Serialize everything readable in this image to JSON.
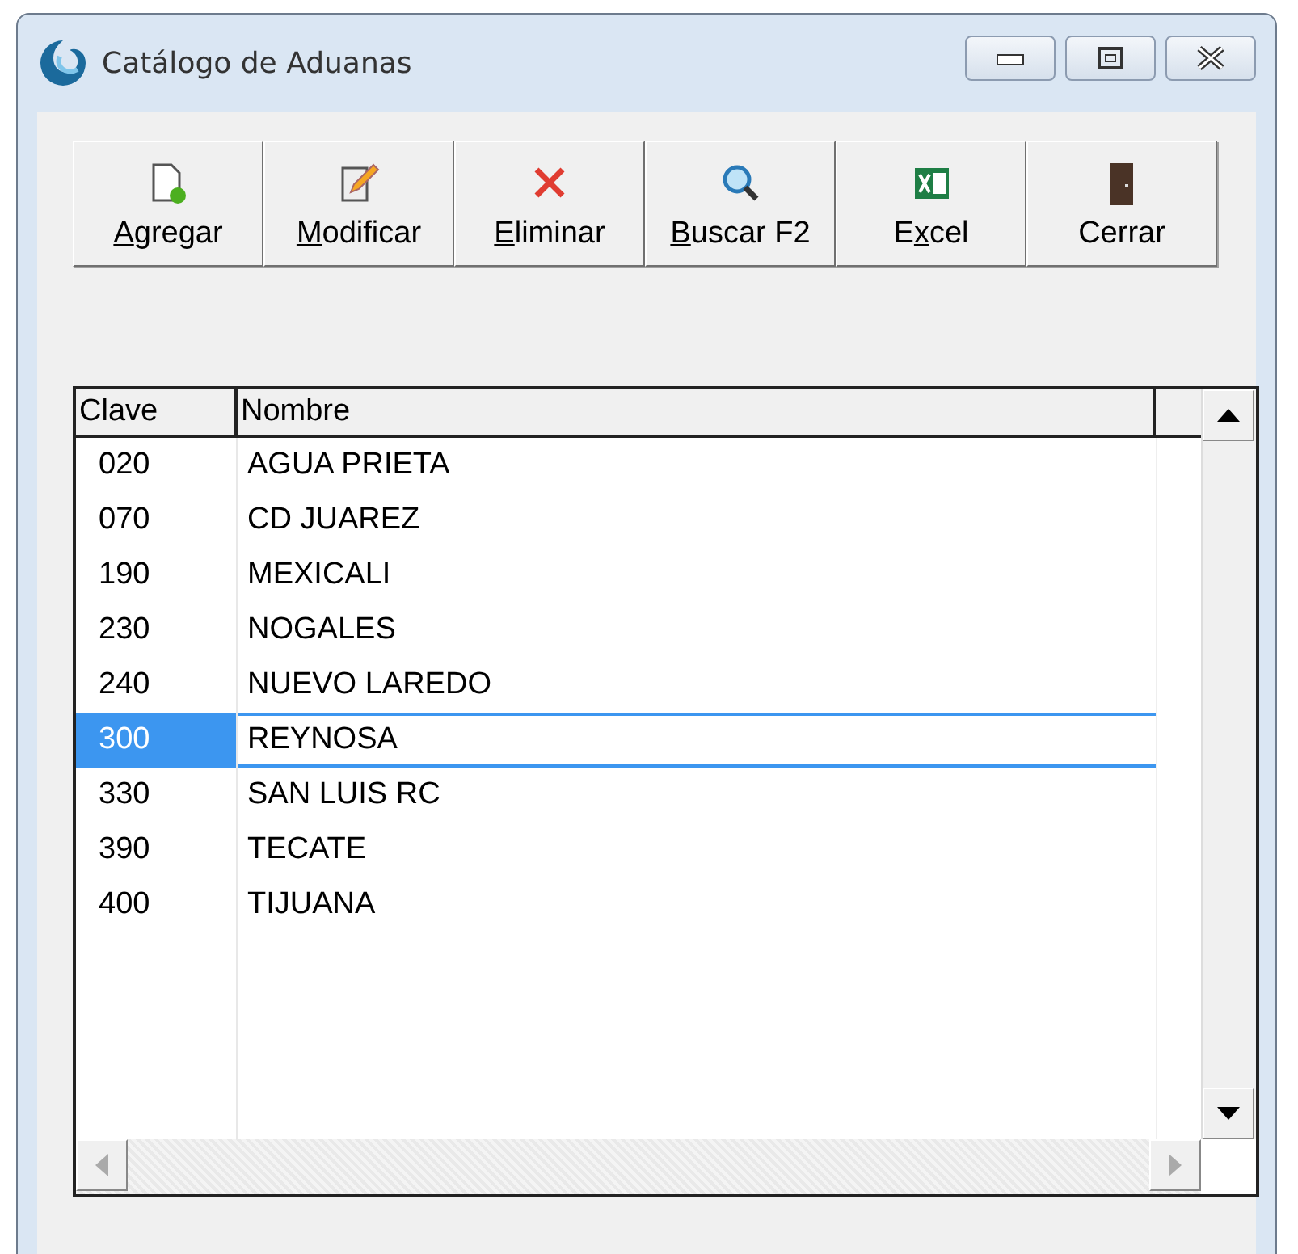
{
  "window": {
    "title": "Catálogo de Aduanas"
  },
  "toolbar": [
    {
      "kind": "add",
      "mnemonic": "A",
      "after": "gregar"
    },
    {
      "kind": "edit",
      "mnemonic": "M",
      "after": "odificar"
    },
    {
      "kind": "delete",
      "mnemonic": "E",
      "after": "liminar"
    },
    {
      "kind": "search",
      "mnemonic": "B",
      "after": "uscar F2"
    },
    {
      "kind": "excel",
      "before": "E",
      "mnemonic": "x",
      "after": "cel"
    },
    {
      "kind": "close",
      "before": "Cerrar"
    }
  ],
  "table": {
    "columns": [
      "Clave",
      "Nombre"
    ],
    "rows": [
      {
        "clave": "020",
        "nombre": "AGUA PRIETA",
        "selected": false
      },
      {
        "clave": "070",
        "nombre": "CD JUAREZ",
        "selected": false
      },
      {
        "clave": "190",
        "nombre": "MEXICALI",
        "selected": false
      },
      {
        "clave": "230",
        "nombre": "NOGALES",
        "selected": false
      },
      {
        "clave": "240",
        "nombre": "NUEVO LAREDO",
        "selected": false
      },
      {
        "clave": "300",
        "nombre": "REYNOSA",
        "selected": true
      },
      {
        "clave": "330",
        "nombre": "SAN LUIS RC",
        "selected": false
      },
      {
        "clave": "390",
        "nombre": "TECATE",
        "selected": false
      },
      {
        "clave": "400",
        "nombre": "TIJUANA",
        "selected": false
      }
    ]
  }
}
